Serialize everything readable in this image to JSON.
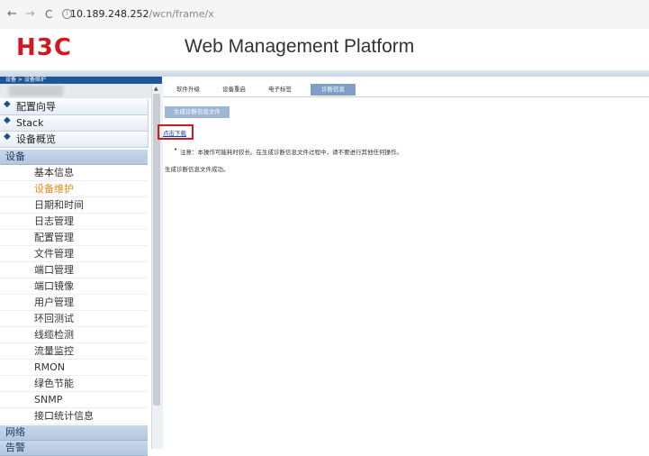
{
  "browser": {
    "back": "←",
    "forward": "→",
    "reload": "C",
    "url_host": "10.189.248.252",
    "url_path": "/wcn/frame/x"
  },
  "header": {
    "logo": "H3C",
    "title": "Web Management Platform",
    "brand_color": "#d01920"
  },
  "breadcrumb": "设备 > 设备维护",
  "sidebar": {
    "top_items": [
      "配置向导",
      "Stack",
      "设备概览"
    ],
    "category": "设备",
    "items": [
      "基本信息",
      "设备维护",
      "日期和时间",
      "日志管理",
      "配置管理",
      "文件管理",
      "端口管理",
      "端口镜像",
      "用户管理",
      "环回测试",
      "线缆检测",
      "流量监控",
      "RMON",
      "绿色节能",
      "SNMP",
      "接口统计信息"
    ],
    "active_item": "设备维护",
    "bottom_categories": [
      "网络",
      "告警"
    ]
  },
  "tabs": [
    "软件升级",
    "设备重启",
    "电子标签",
    "诊断信息"
  ],
  "active_tab": "诊断信息",
  "content": {
    "generate_button": "生成诊断信息文件",
    "download_link": "点击下载",
    "notice": "注意：本操作可能耗时较长。在生成诊断信息文件过程中，请不要进行其他任何操作。",
    "success": "生成诊断信息文件成功。"
  }
}
